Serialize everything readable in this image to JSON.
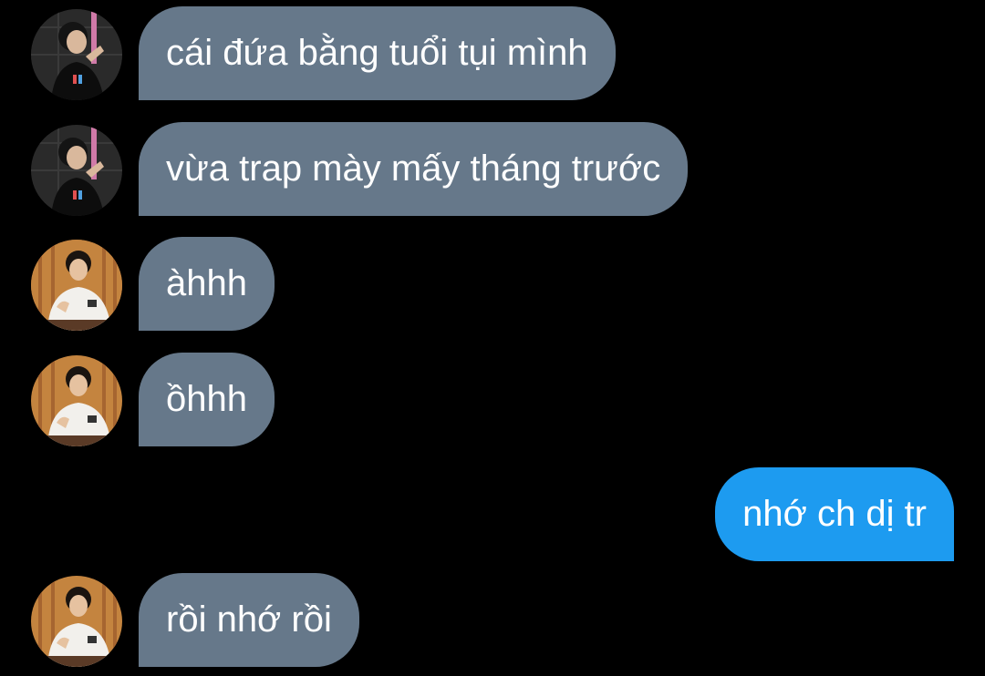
{
  "conversation": {
    "messages": [
      {
        "sender": "user-a",
        "text": "cái đứa bằng tuổi tụi mình"
      },
      {
        "sender": "user-a",
        "text": "vừa trap mày mấy tháng trước"
      },
      {
        "sender": "user-b",
        "text": "àhhh"
      },
      {
        "sender": "user-b",
        "text": "ồhhh"
      },
      {
        "sender": "me",
        "text": "nhớ ch dị tr"
      },
      {
        "sender": "user-b",
        "text": "rồi nhớ rồi"
      }
    ]
  },
  "colors": {
    "background": "#000000",
    "incoming_bubble": "#66788a",
    "outgoing_bubble": "#1d9bf0",
    "text": "#ffffff"
  }
}
